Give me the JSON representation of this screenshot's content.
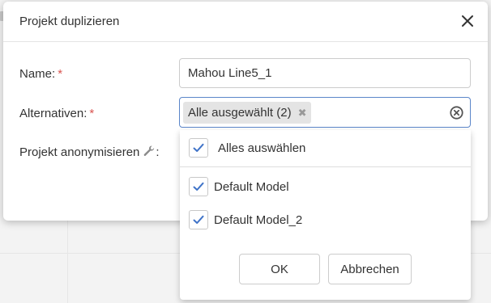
{
  "dialog": {
    "title": "Projekt duplizieren",
    "close_icon": "close-icon"
  },
  "form": {
    "name_label": "Name:",
    "name_value": "Mahou Line5_1",
    "alternatives_label": "Alternativen:",
    "required_marker": "*",
    "anonymize_label": "Projekt anonymisieren",
    "anonymize_suffix": ":",
    "wrench_icon": "wrench-icon"
  },
  "multiselect": {
    "tag_label": "Alle ausgewählt (2)",
    "tag_remove": "✖",
    "clear_icon": "clear-circle-icon"
  },
  "dropdown": {
    "select_all_label": "Alles auswählen",
    "options": [
      {
        "label": "Default Model",
        "checked": true
      },
      {
        "label": "Default Model_2",
        "checked": true
      }
    ],
    "ok_label": "OK",
    "cancel_label": "Abbrechen"
  },
  "colors": {
    "required": "#d9534f",
    "check": "#3f73c8",
    "focus_border": "#5b86c9"
  }
}
